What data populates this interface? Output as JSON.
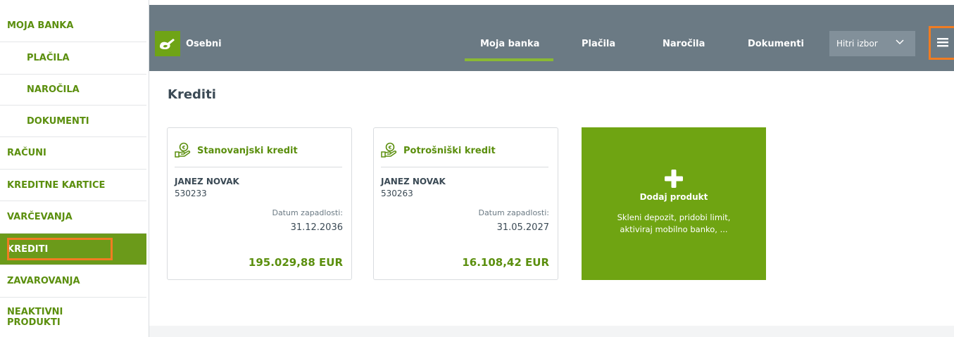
{
  "sidebar": {
    "items": [
      {
        "label": "MOJA BANKA"
      },
      {
        "label": "PLAČILA"
      },
      {
        "label": "NAROČILA"
      },
      {
        "label": "DOKUMENTI"
      },
      {
        "label": "RAČUNI"
      },
      {
        "label": "KREDITNE KARTICE"
      },
      {
        "label": "VARČEVANJA"
      },
      {
        "label": "KREDITI"
      },
      {
        "label": "ZAVAROVANJA"
      },
      {
        "label_line1": "NEAKTIVNI",
        "label_line2": "PRODUKTI"
      }
    ],
    "active": "KREDITI"
  },
  "header": {
    "brand": "Osebni",
    "nav": [
      {
        "label": "Moja banka"
      },
      {
        "label": "Plačila"
      },
      {
        "label": "Naročila"
      },
      {
        "label": "Dokumenti"
      }
    ],
    "active_nav": "Moja banka",
    "quick_select": "Hitri izbor"
  },
  "main": {
    "title": "Krediti",
    "cards": [
      {
        "title": "Stanovanjski kredit",
        "owner": "JANEZ NOVAK",
        "account": "530233",
        "date_label": "Datum zapadlosti:",
        "date": "31.12.2036",
        "amount": "195.029,88 EUR"
      },
      {
        "title": "Potrošniški kredit",
        "owner": "JANEZ NOVAK",
        "account": "530263",
        "date_label": "Datum zapadlosti:",
        "date": "31.05.2027",
        "amount": "16.108,42 EUR"
      }
    ],
    "add_product": {
      "title": "Dodaj produkt",
      "desc_line1": "Skleni depozit, pridobi limit,",
      "desc_line2": "aktiviraj mobilno banko, ..."
    }
  },
  "colors": {
    "brand_green": "#6fa412",
    "text_green": "#5b8f0e",
    "header_gray": "#6b7a84",
    "highlight_orange": "#f07c22"
  },
  "icons": [
    "bank-logo-icon",
    "chevron-down-icon",
    "hamburger-menu-icon",
    "hand-coin-icon",
    "plus-icon"
  ]
}
